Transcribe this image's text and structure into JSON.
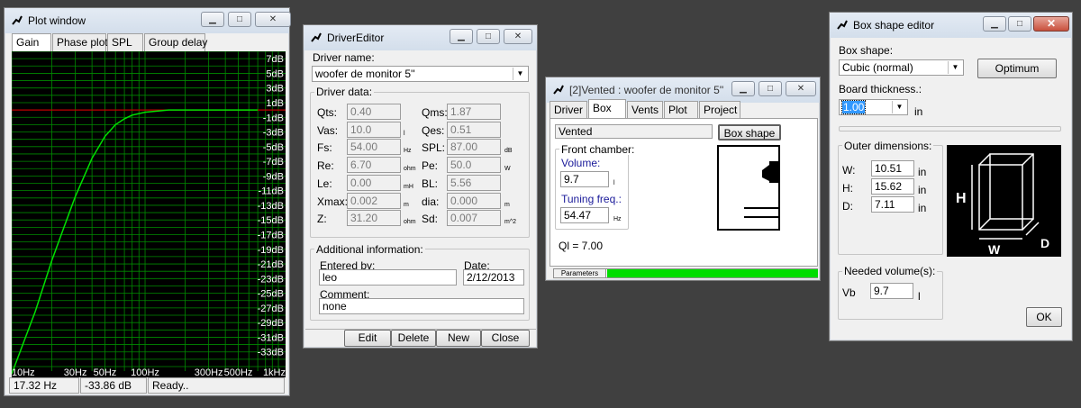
{
  "colors": {
    "plot_bg": "#000000",
    "grid": "#008a00",
    "curve": "#00e000",
    "ref_line": "#c00000",
    "progress": "#00dd00"
  },
  "plot": {
    "title": "Plot window",
    "tabs": [
      "Gain",
      "Phase plot",
      "SPL",
      "Group delay"
    ],
    "y_ticks": [
      "7dB",
      "5dB",
      "3dB",
      "1dB",
      "-1dB",
      "-3dB",
      "-5dB",
      "-7dB",
      "-9dB",
      "-11dB",
      "-13dB",
      "-15dB",
      "-17dB",
      "-19dB",
      "-21dB",
      "-23dB",
      "-25dB",
      "-27dB",
      "-29dB",
      "-31dB",
      "-33dB"
    ],
    "x_ticks": [
      "10Hz",
      "30Hz",
      "50Hz",
      "100Hz",
      "300Hz",
      "500Hz",
      "1kHz"
    ],
    "status": {
      "freq": "17.32 Hz",
      "gain": "-33.86 dB",
      "state": "Ready.."
    }
  },
  "chart_data": {
    "type": "line",
    "title": "",
    "xlabel": "",
    "ylabel": "",
    "x_scale": "log",
    "xlim": [
      10,
      1000
    ],
    "ylim": [
      -35,
      8
    ],
    "reference_line_y": 0,
    "series": [
      {
        "x": [
          10,
          15,
          20,
          25,
          30,
          40,
          50,
          60,
          70,
          80,
          100,
          150,
          200,
          300,
          500,
          700
        ],
        "y": [
          -36,
          -27.5,
          -20.5,
          -15.7,
          -11.8,
          -6.6,
          -3.6,
          -2.0,
          -1.2,
          -0.7,
          -0.3,
          0,
          0,
          0,
          0,
          0
        ]
      }
    ]
  },
  "driver": {
    "title": "DriverEditor",
    "name_label": "Driver name:",
    "name_value": "woofer de monitor 5''",
    "data_group": "Driver data:",
    "fields_left": [
      {
        "label": "Qts:",
        "value": "0.40",
        "unit": ""
      },
      {
        "label": "Vas:",
        "value": "10.0",
        "unit": "l"
      },
      {
        "label": "Fs:",
        "value": "54.00",
        "unit": "Hz"
      },
      {
        "label": "Re:",
        "value": "6.70",
        "unit": "ohm"
      },
      {
        "label": "Le:",
        "value": "0.00",
        "unit": "mH"
      },
      {
        "label": "Xmax:",
        "value": "0.002",
        "unit": "m"
      },
      {
        "label": "Z:",
        "value": "31.20",
        "unit": "ohm"
      }
    ],
    "fields_right": [
      {
        "label": "Qms:",
        "value": "1.87",
        "unit": ""
      },
      {
        "label": "Qes:",
        "value": "0.51",
        "unit": ""
      },
      {
        "label": "SPL:",
        "value": "87.00",
        "unit": "dB"
      },
      {
        "label": "Pe:",
        "value": "50.0",
        "unit": "W"
      },
      {
        "label": "BL:",
        "value": "5.56",
        "unit": ""
      },
      {
        "label": "dia:",
        "value": "0.000",
        "unit": "m"
      },
      {
        "label": "Sd:",
        "value": "0.007",
        "unit": "m^2"
      }
    ],
    "info_group": "Additional information:",
    "entered_label": "Entered by:",
    "entered_value": "leo",
    "date_label": "Date:",
    "date_value": "2/12/2013",
    "comment_label": "Comment:",
    "comment_value": "none",
    "buttons": [
      "Edit",
      "Delete",
      "New",
      "Close"
    ]
  },
  "vented": {
    "title": "[2]Vented : woofer de monitor 5''",
    "tabs": [
      "Driver",
      "Box",
      "Vents",
      "Plot",
      "Project"
    ],
    "type_value": "Vented",
    "box_shape_btn": "Box shape",
    "front_group": "Front chamber:",
    "volume_label": "Volume:",
    "volume_value": "9.7",
    "volume_unit": "l",
    "tuning_label": "Tuning freq.:",
    "tuning_value": "54.47",
    "tuning_unit": "Hz",
    "ql": "Ql = 7.00",
    "progress_label": "Parameters",
    "progress_fraction": 1.0
  },
  "boxshape": {
    "title": "Box shape editor",
    "shape_label": "Box shape:",
    "shape_value": "Cubic (normal)",
    "optimum_btn": "Optimum",
    "thickness_label": "Board thickness.:",
    "thickness_value": "1.00",
    "thickness_unit": "in",
    "outer_group": "Outer dimensions:",
    "dims": [
      {
        "label": "W:",
        "value": "10.51",
        "unit": "in"
      },
      {
        "label": "H:",
        "value": "15.62",
        "unit": "in"
      },
      {
        "label": "D:",
        "value": "7.11",
        "unit": "in"
      }
    ],
    "diagram_labels": {
      "h": "H",
      "w": "W",
      "d": "D"
    },
    "needed_group": "Needed volume(s):",
    "vb_label": "Vb",
    "vb_value": "9.7",
    "vb_unit": "l",
    "ok_btn": "OK"
  }
}
